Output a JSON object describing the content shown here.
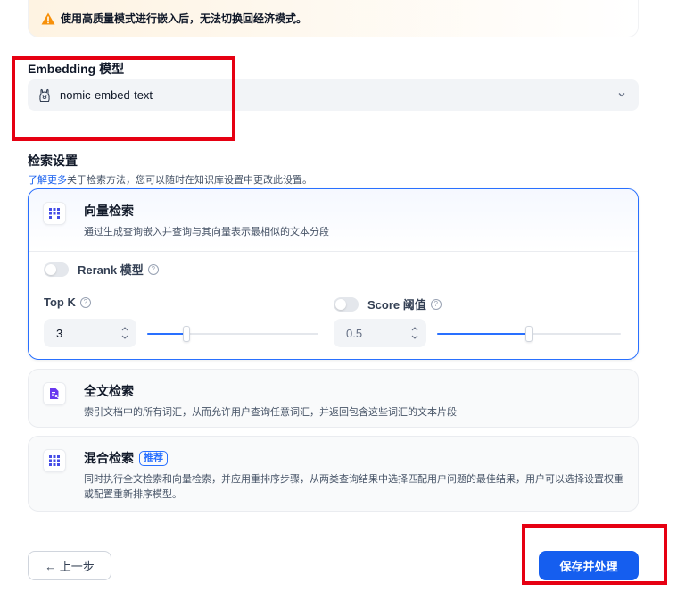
{
  "warning": {
    "text": "使用高质量模式进行嵌入后，无法切换回经济模式。"
  },
  "embedding": {
    "title": "Embedding 模型",
    "selected_model": "nomic-embed-text",
    "model_icon": "ollama-llama-icon"
  },
  "retrieval": {
    "title": "检索设置",
    "learn_more": "了解更多",
    "subtitle_rest": "关于检索方法，您可以随时在知识库设置中更改此设置。",
    "methods": [
      {
        "title": "向量检索",
        "desc": "通过生成查询嵌入并查询与其向量表示最相似的文本分段",
        "icon": "vector-grid-icon",
        "active": true
      },
      {
        "title": "全文检索",
        "desc": "索引文档中的所有词汇，从而允许用户查询任意词汇，并返回包含这些词汇的文本片段",
        "icon": "fulltext-doc-icon",
        "active": false
      },
      {
        "title": "混合检索",
        "badge": "推荐",
        "desc": "同时执行全文检索和向量检索，并应用重排序步骤，从两类查询结果中选择匹配用户问题的最佳结果，用户可以选择设置权重或配置重新排序模型。",
        "icon": "hybrid-grid-icon",
        "active": false
      }
    ],
    "rerank": {
      "label": "Rerank 模型",
      "enabled": false
    },
    "top_k": {
      "label": "Top K",
      "value": "3",
      "slider_fraction": 0.23
    },
    "score": {
      "label": "Score 阈值",
      "value": "0.5",
      "enabled": false,
      "slider_fraction": 0.5
    }
  },
  "buttons": {
    "back": "← 上一步",
    "save": "保存并处理"
  },
  "colors": {
    "primary": "#155eef",
    "active_border": "#2970ff",
    "annotation_red": "#e60012",
    "warning_icon": "#f79009"
  }
}
